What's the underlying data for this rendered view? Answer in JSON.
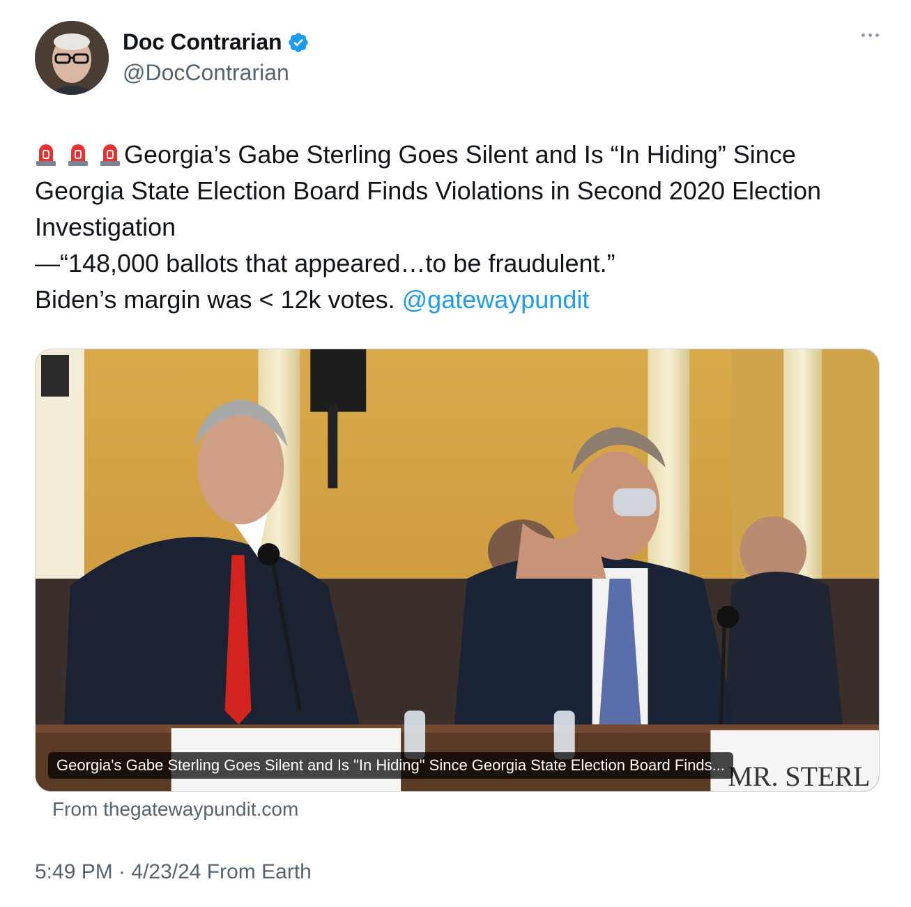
{
  "author": {
    "display_name": "Doc Contrarian",
    "handle": "@DocContrarian",
    "verified": true,
    "verified_color": "#1d9bf0"
  },
  "tweet": {
    "siren_count": 3,
    "lines": [
      "Georgia’s Gabe Sterling Goes Silent and Is “In Hiding” Since",
      "Georgia State Election Board Finds Violations in Second 2020 Election",
      "Investigation",
      "—“148,000 ballots that appeared…to be fraudulent.”",
      "Biden’s margin was < 12k votes."
    ],
    "mention": "@gatewaypundit",
    "mention_color": "#1d9bf0"
  },
  "media": {
    "caption": "Georgia's Gabe Sterling Goes Silent and Is \"In Hiding\" Since Georgia State Election Board Finds...",
    "nameplate_right": "MR. STERL",
    "source": "From thegatewaypundit.com"
  },
  "meta": {
    "timestamp": "5:49 PM · 4/23/24 From Earth"
  }
}
